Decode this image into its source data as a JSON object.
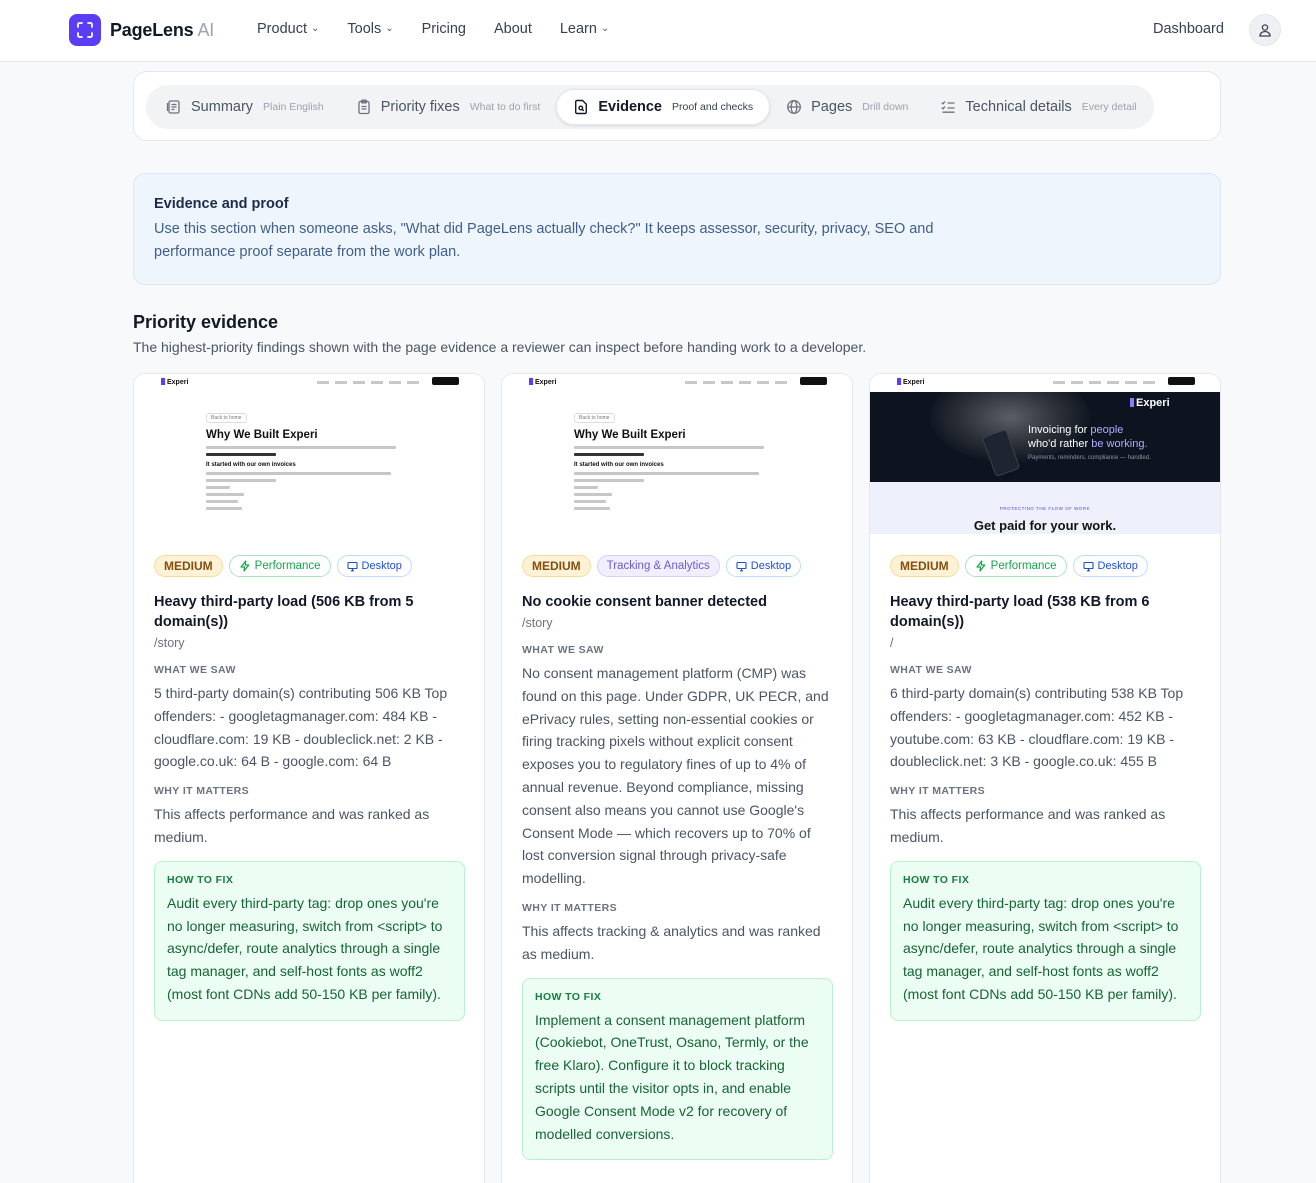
{
  "nav": {
    "brand": "PageLens",
    "brand_suffix": "AI",
    "links": [
      {
        "label": "Product",
        "dropdown": true
      },
      {
        "label": "Tools",
        "dropdown": true
      },
      {
        "label": "Pricing",
        "dropdown": false
      },
      {
        "label": "About",
        "dropdown": false
      },
      {
        "label": "Learn",
        "dropdown": true
      }
    ],
    "dashboard": "Dashboard",
    "icons": {
      "logo": "scan-frame-icon",
      "avatar": "user-icon",
      "dropdown": "chevron-down-icon"
    }
  },
  "tabs": [
    {
      "label": "Summary",
      "sub": "Plain English",
      "icon": "document-list-icon",
      "active": false
    },
    {
      "label": "Priority fixes",
      "sub": "What to do first",
      "icon": "clipboard-icon",
      "active": false
    },
    {
      "label": "Evidence",
      "sub": "Proof and checks",
      "icon": "file-search-icon",
      "active": true
    },
    {
      "label": "Pages",
      "sub": "Drill down",
      "icon": "globe-icon",
      "active": false
    },
    {
      "label": "Technical details",
      "sub": "Every detail",
      "icon": "checklist-icon",
      "active": false
    }
  ],
  "info": {
    "title": "Evidence and proof",
    "body": "Use this section when someone asks, \"What did PageLens actually check?\" It keeps assessor, security, privacy, SEO and performance proof separate from the work plan."
  },
  "section": {
    "title": "Priority evidence",
    "subtitle": "The highest-priority findings shown with the page evidence a reviewer can inspect before handing work to a developer."
  },
  "thumbs": {
    "site_name": "Experi",
    "back": "Back to home",
    "heading": "Why We Built Experi",
    "subheading": "It started with our own invoices",
    "hero_brand": "Experi",
    "hero_line1_a": "Invoicing for ",
    "hero_line1_b": "people",
    "hero_line2_a": "who'd rather ",
    "hero_line2_b": "be working.",
    "hero_line3": "Payments, reminders, compliance — handled.",
    "hero_kicker": "PROTECTING THE FLOW OF WORK",
    "hero_cta": "Get paid for your work."
  },
  "labels": {
    "saw": "WHAT WE SAW",
    "matters": "WHY IT MATTERS",
    "fix": "HOW TO FIX"
  },
  "cards": [
    {
      "severity": "MEDIUM",
      "category": "Performance",
      "category_icon": "lightning-icon",
      "device": "Desktop",
      "device_icon": "monitor-icon",
      "title": "Heavy third-party load (506 KB from 5 domain(s))",
      "path": "/story",
      "saw": "5 third-party domain(s) contributing 506 KB Top offenders: - googletagmanager.com: 484 KB - cloudflare.com: 19 KB - doubleclick.net: 2 KB - google.co.uk: 64 B - google.com: 64 B",
      "matters": "This affects performance and was ranked as medium.",
      "fix": "Audit every third-party tag: drop ones you're no longer measuring, switch from <script> to async/defer, route analytics through a single tag manager, and self-host fonts as woff2 (most font CDNs add 50-150 KB per family)."
    },
    {
      "severity": "MEDIUM",
      "category": "Tracking & Analytics",
      "device": "Desktop",
      "device_icon": "monitor-icon",
      "title": "No cookie consent banner detected",
      "path": "/story",
      "saw": "No consent management platform (CMP) was found on this page. Under GDPR, UK PECR, and ePrivacy rules, setting non-essential cookies or firing tracking pixels without explicit consent exposes you to regulatory fines of up to 4% of annual revenue. Beyond compliance, missing consent also means you cannot use Google's Consent Mode — which recovers up to 70% of lost conversion signal through privacy-safe modelling.",
      "matters": "This affects tracking & analytics and was ranked as medium.",
      "fix": "Implement a consent management platform (Cookiebot, OneTrust, Osano, Termly, or the free Klaro). Configure it to block tracking scripts until the visitor opts in, and enable Google Consent Mode v2 for recovery of modelled conversions."
    },
    {
      "severity": "MEDIUM",
      "category": "Performance",
      "category_icon": "lightning-icon",
      "device": "Desktop",
      "device_icon": "monitor-icon",
      "title": "Heavy third-party load (538 KB from 6 domain(s))",
      "path": "/",
      "saw": "6 third-party domain(s) contributing 538 KB Top offenders: - googletagmanager.com: 452 KB - youtube.com: 63 KB - cloudflare.com: 19 KB - doubleclick.net: 3 KB - google.co.uk: 455 B",
      "matters": "This affects performance and was ranked as medium.",
      "fix": "Audit every third-party tag: drop ones you're no longer measuring, switch from <script> to async/defer, route analytics through a single tag manager, and self-host fonts as woff2 (most font CDNs add 50-150 KB per family)."
    }
  ]
}
